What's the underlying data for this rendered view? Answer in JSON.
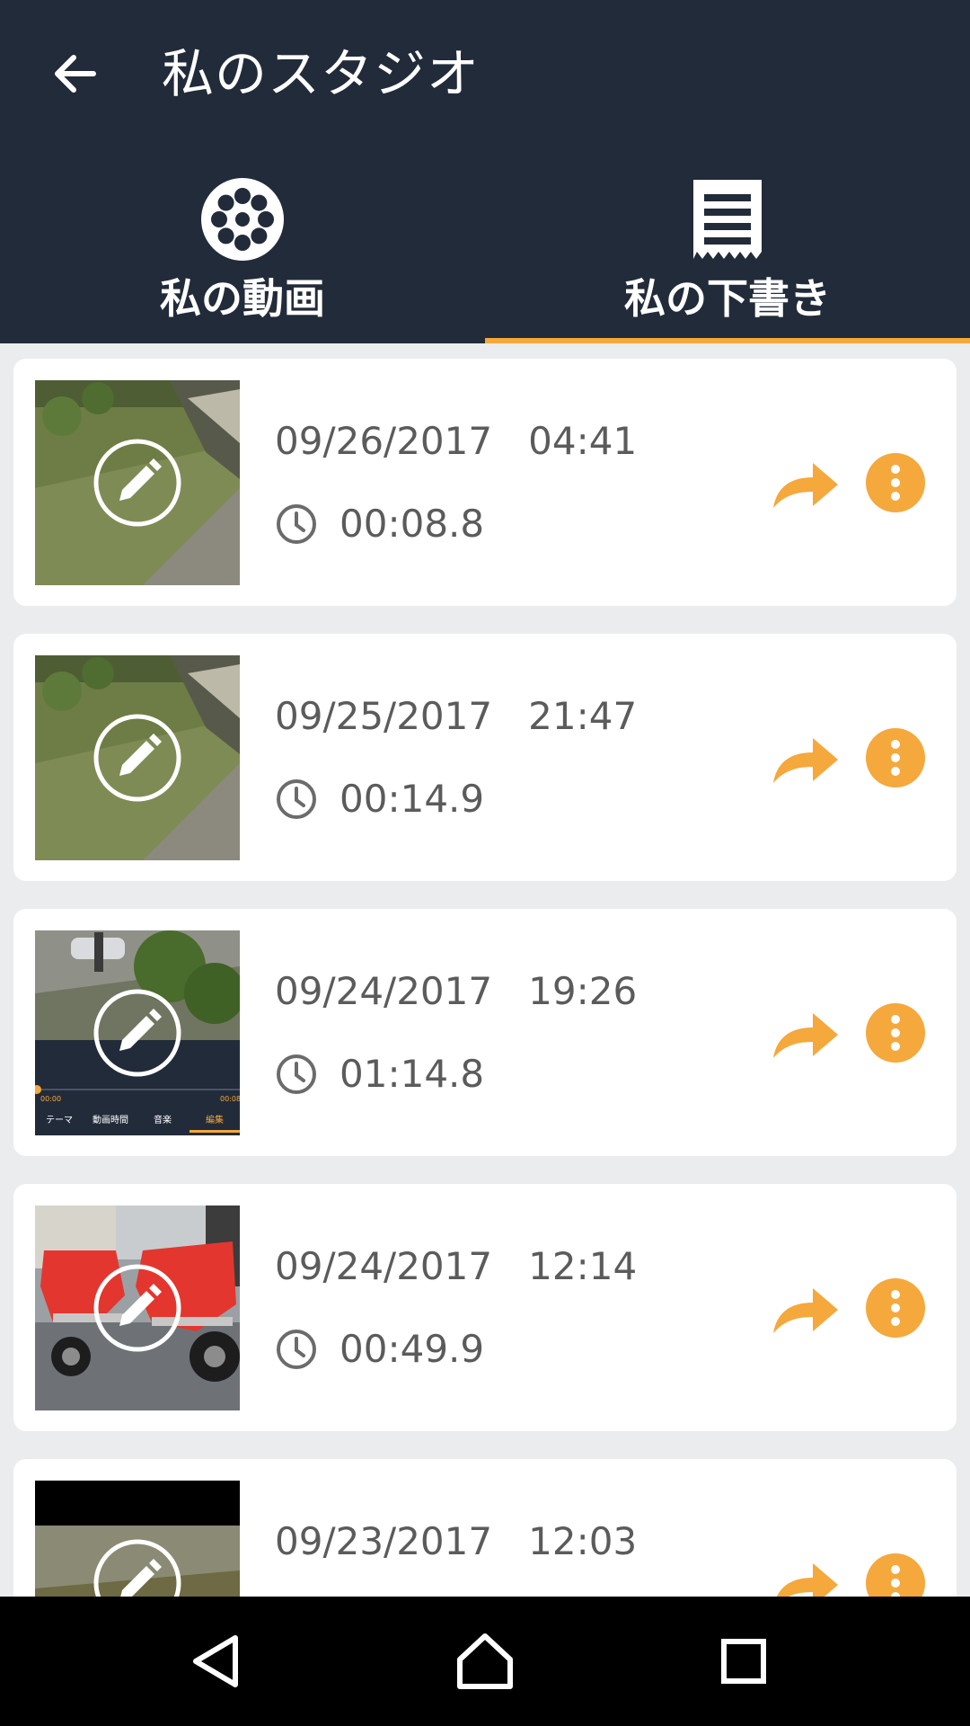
{
  "header": {
    "back_icon": "arrow-left-icon",
    "title": "私のスタジオ"
  },
  "tabs": [
    {
      "label": "私の動画",
      "icon": "film-reel-icon",
      "active": false
    },
    {
      "label": "私の下書き",
      "icon": "draft-document-icon",
      "active": true
    }
  ],
  "colors": {
    "appbar": "#222b39",
    "accent": "#f5a83c",
    "text": "#5b5b5b",
    "background": "#ebecee"
  },
  "drafts": [
    {
      "date": "09/26/2017   04:41",
      "duration": "00:08.8",
      "thumbnail": "grass-yard"
    },
    {
      "date": "09/25/2017   21:47",
      "duration": "00:14.9",
      "thumbnail": "grass-yard"
    },
    {
      "date": "09/24/2017   19:26",
      "duration": "01:14.8",
      "thumbnail": "editor-screenshot"
    },
    {
      "date": "09/24/2017   12:14",
      "duration": "00:49.9",
      "thumbnail": "red-motorcycles"
    },
    {
      "date": "09/23/2017   12:03",
      "duration": "",
      "thumbnail": "fence-garden"
    }
  ],
  "thumbnail_editor_tabs": [
    "テーマ",
    "動画時間",
    "音楽",
    "編集"
  ],
  "thumbnail_editor_times": [
    "00:00",
    "00:08"
  ],
  "icons": {
    "edit": "pencil-icon",
    "clock": "clock-icon",
    "share": "share-arrow-icon",
    "more": "more-vertical-icon"
  },
  "navbar": [
    "back-triangle-icon",
    "home-icon",
    "recents-square-icon"
  ]
}
